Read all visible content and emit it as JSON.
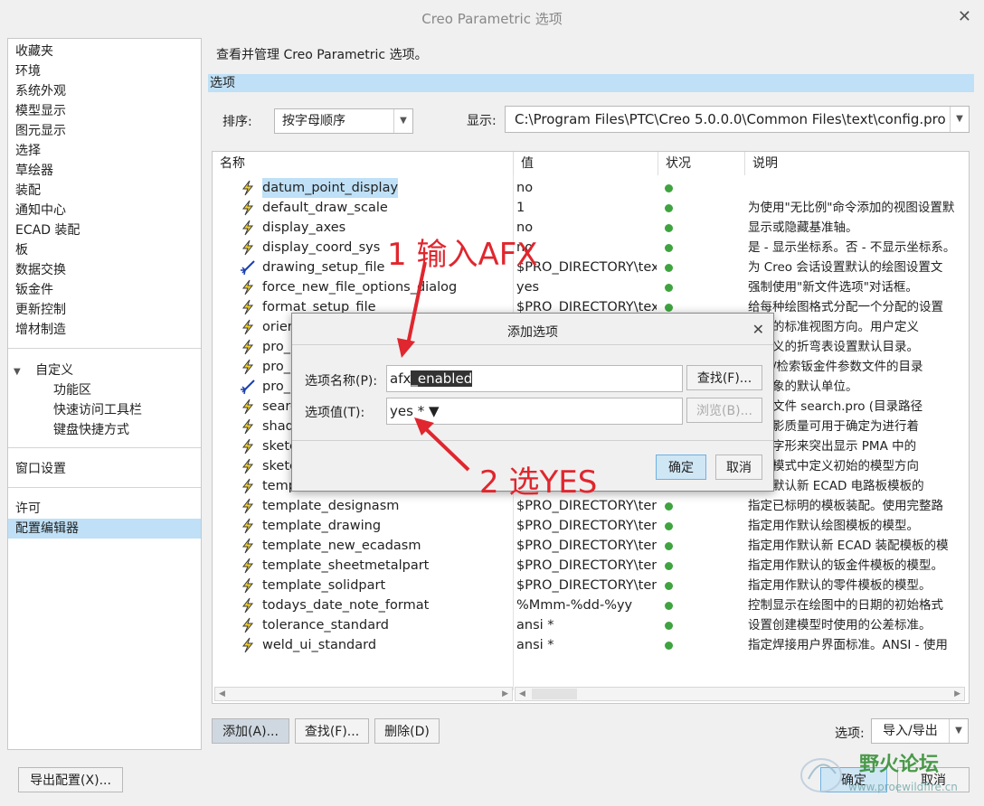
{
  "window": {
    "title": "Creo Parametric 选项"
  },
  "sidebar": {
    "items": [
      "收藏夹",
      "环境",
      "系统外观",
      "模型显示",
      "图元显示",
      "选择",
      "草绘器",
      "装配",
      "通知中心",
      "ECAD 装配",
      "板",
      "数据交换",
      "钣金件",
      "更新控制",
      "增材制造"
    ],
    "custom": {
      "label": "自定义",
      "children": [
        "功能区",
        "快速访问工具栏",
        "键盘快捷方式"
      ]
    },
    "window_settings": "窗口设置",
    "license": "许可",
    "config_editor": "配置编辑器"
  },
  "main": {
    "description": "查看并管理 Creo Parametric 选项。",
    "section": "选项",
    "sort_label": "排序:",
    "sort_value": "按字母顺序",
    "display_label": "显示:",
    "display_value": "C:\\Program Files\\PTC\\Creo 5.0.0.0\\Common Files\\text\\config.pro"
  },
  "table": {
    "headers": [
      "名称",
      "值",
      "状况",
      "说明"
    ],
    "rows": [
      {
        "icon": "bolt",
        "name": "datum_point_display",
        "value": "no",
        "desc": ""
      },
      {
        "icon": "bolt",
        "name": "default_draw_scale",
        "value": "1",
        "desc": "为使用\"无比例\"命令添加的视图设置默"
      },
      {
        "icon": "bolt",
        "name": "display_axes",
        "value": "no",
        "desc": "显示或隐藏基准轴。"
      },
      {
        "icon": "bolt",
        "name": "display_coord_sys",
        "value": "no",
        "desc": "是 - 显示坐标系。否 - 不显示坐标系。"
      },
      {
        "icon": "star",
        "name": "drawing_setup_file",
        "value": "$PRO_DIRECTORY\\tex",
        "desc": "为 Creo 会话设置默认的绘图设置文"
      },
      {
        "icon": "bolt",
        "name": "force_new_file_options_dialog",
        "value": "yes",
        "desc": "强制使用\"新文件选项\"对话框。"
      },
      {
        "icon": "bolt",
        "name": "format_setup_file",
        "value": "$PRO_DIRECTORY\\tex",
        "desc": "给每种绘图格式分配一个分配的设置"
      },
      {
        "icon": "bolt",
        "name": "orientation",
        "value": "",
        "desc": "初始的标准视图方向。用户定义"
      },
      {
        "icon": "bolt",
        "name": "pro_",
        "value": "",
        "desc": "户定义的折弯表设置默认目录。"
      },
      {
        "icon": "bolt",
        "name": "pro_",
        "value": "",
        "desc": "保存/检索钣金件参数文件的目录"
      },
      {
        "icon": "star",
        "name": "pro_",
        "value": "",
        "desc": "新对象的默认单位。"
      },
      {
        "icon": "bolt",
        "name": "search",
        "value": "",
        "desc": "文本文件 search.pro (目录路径"
      },
      {
        "icon": "bolt",
        "name": "shade",
        "value": "",
        "desc": "的阴影质量可用于确定为进行着"
      },
      {
        "icon": "bolt",
        "name": "sketcher",
        "value": "",
        "desc": "使用字形来突出显示 PMA 中的"
      },
      {
        "icon": "bolt",
        "name": "sketcher",
        "value": "",
        "desc": "绘器模式中定义初始的模型方向"
      },
      {
        "icon": "bolt",
        "name": "template",
        "value": "",
        "desc": "用作默认新 ECAD 电路板模板的"
      },
      {
        "icon": "bolt",
        "name": "template_designasm",
        "value": "$PRO_DIRECTORY\\ten",
        "desc": "指定已标明的模板装配。使用完整路"
      },
      {
        "icon": "bolt",
        "name": "template_drawing",
        "value": "$PRO_DIRECTORY\\ten",
        "desc": "指定用作默认绘图模板的模型。"
      },
      {
        "icon": "bolt",
        "name": "template_new_ecadasm",
        "value": "$PRO_DIRECTORY\\ten",
        "desc": "指定用作默认新 ECAD 装配模板的模"
      },
      {
        "icon": "bolt",
        "name": "template_sheetmetalpart",
        "value": "$PRO_DIRECTORY\\ten",
        "desc": "指定用作默认的钣金件模板的模型。"
      },
      {
        "icon": "bolt",
        "name": "template_solidpart",
        "value": "$PRO_DIRECTORY\\ten",
        "desc": "指定用作默认的零件模板的模型。"
      },
      {
        "icon": "bolt",
        "name": "todays_date_note_format",
        "value": "%Mmm-%dd-%yy",
        "desc": "控制显示在绘图中的日期的初始格式"
      },
      {
        "icon": "bolt",
        "name": "tolerance_standard",
        "value": "ansi *",
        "desc": "设置创建模型时使用的公差标准。"
      },
      {
        "icon": "bolt",
        "name": "weld_ui_standard",
        "value": "ansi *",
        "desc": "指定焊接用户界面标准。ANSI - 使用"
      }
    ]
  },
  "bottom": {
    "add": "添加(A)...",
    "find": "查找(F)...",
    "delete": "删除(D)",
    "options_label": "选项:",
    "import_export": "导入/导出",
    "export_config": "导出配置(X)...",
    "ok": "确定",
    "cancel": "取消"
  },
  "dialog": {
    "title": "添加选项",
    "name_label": "选项名称(P):",
    "name_prefix": "afx",
    "name_selected": "_enabled",
    "find_button": "查找(F)...",
    "value_label": "选项值(T):",
    "value": "yes *",
    "browse_button": "浏览(B)...",
    "ok": "确定",
    "cancel": "取消"
  },
  "annotations": {
    "step1": "1 输入AFX",
    "step2": "2 选YES"
  },
  "watermark": {
    "text": "野火论坛",
    "url": "www.proewildfire.cn"
  },
  "colors": {
    "selection": "#bfe0f6",
    "status_ok": "#3fa33f",
    "annotation": "#e0262e"
  }
}
